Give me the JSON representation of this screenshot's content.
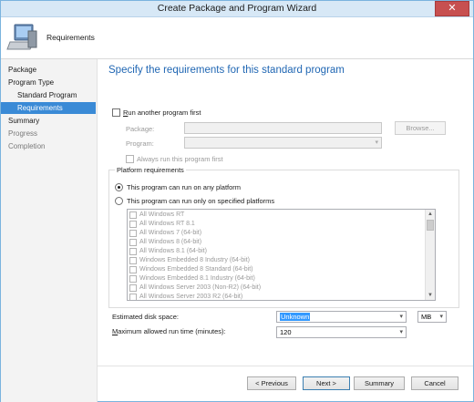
{
  "window": {
    "title": "Create Package and Program Wizard",
    "close_glyph": "✕"
  },
  "header": {
    "title": "Requirements",
    "icon": "computer-icon"
  },
  "nav": {
    "items": [
      {
        "label": "Package"
      },
      {
        "label": "Program Type"
      },
      {
        "label": "Standard Program"
      },
      {
        "label": "Requirements"
      },
      {
        "label": "Summary"
      },
      {
        "label": "Progress"
      },
      {
        "label": "Completion"
      }
    ]
  },
  "page": {
    "heading": "Specify the requirements for this standard program",
    "run_another": {
      "label_hotkey": "R",
      "label_rest": "un another program first",
      "checked": false,
      "package_label": "Package:",
      "program_label": "Program:",
      "browse_label": "Browse...",
      "always_run_label": "Always run this program first"
    },
    "platform": {
      "group_title": "Platform requirements",
      "any_label": "This program can run on any platform",
      "specified_label": "This program can run only on specified platforms",
      "selected": "any",
      "items": [
        "All Windows RT",
        "All Windows RT 8.1",
        "All Windows 7 (64-bit)",
        "All Windows 8 (64-bit)",
        "All Windows 8.1 (64-bit)",
        "Windows Embedded 8 Industry (64-bit)",
        "Windows Embedded 8 Standard (64-bit)",
        "Windows Embedded 8.1 Industry (64-bit)",
        "All Windows Server 2003 (Non-R2) (64-bit)",
        "All Windows Server 2003 R2 (64-bit)"
      ]
    },
    "disk_space": {
      "label": "Estimated disk space:",
      "value": "Unknown",
      "unit": "MB"
    },
    "max_run_time": {
      "label_hotkey": "M",
      "label_rest": "aximum allowed run time (minutes):",
      "value": "120"
    }
  },
  "buttons": {
    "previous": "< Previous",
    "next": "Next >",
    "summary": "Summary",
    "cancel": "Cancel"
  },
  "colors": {
    "accent": "#3a8ad6",
    "heading": "#1f66b3",
    "titlebar": "#d7e8f6",
    "close": "#c75050"
  }
}
